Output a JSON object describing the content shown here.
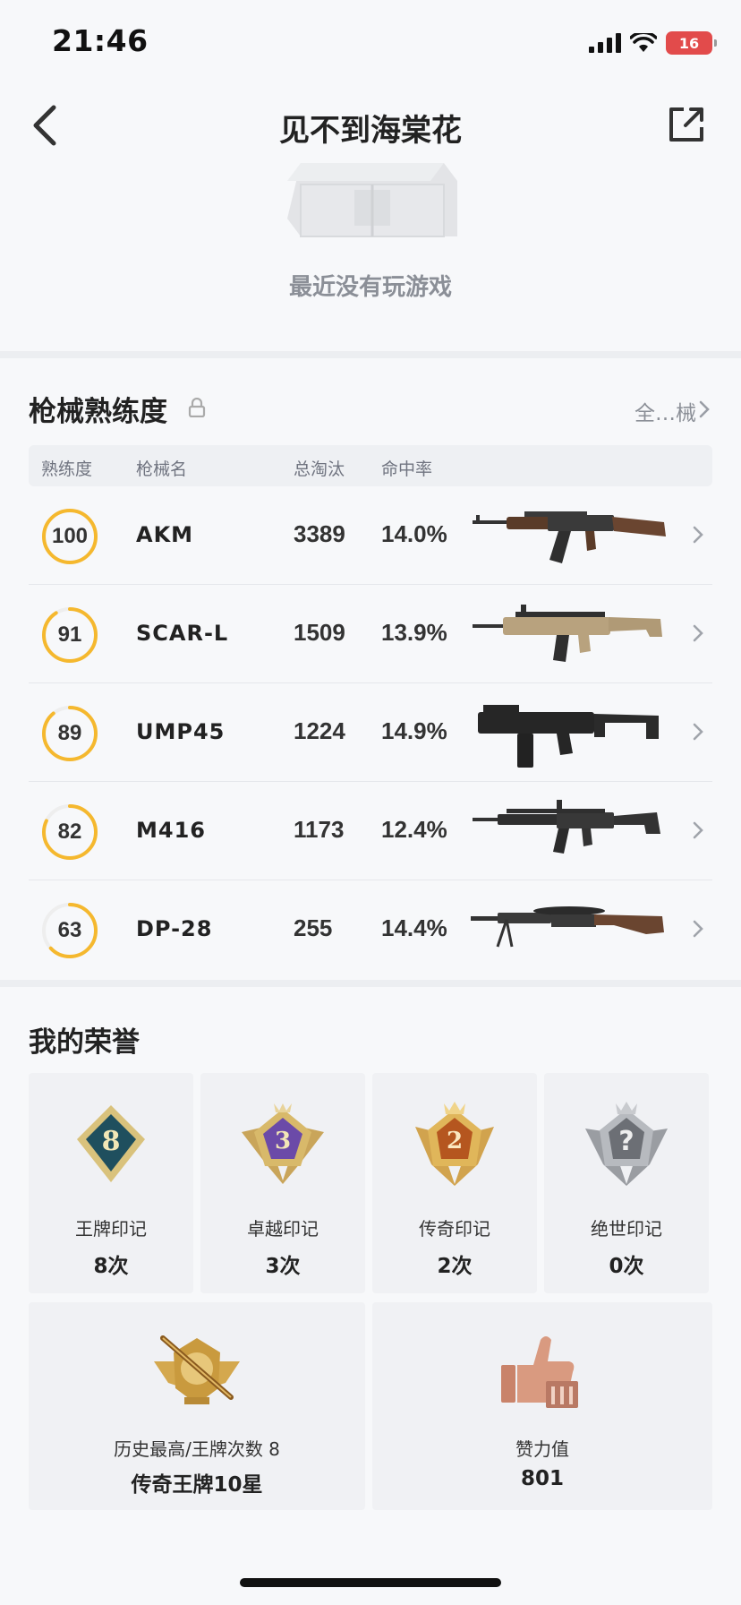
{
  "status_bar": {
    "time": "21:46",
    "battery": "16"
  },
  "header": {
    "title": "见不到海棠花"
  },
  "recent_games": {
    "empty_text": "最近没有玩游戏"
  },
  "weapons": {
    "title": "枪械熟练度",
    "all_link": "全…械",
    "columns": {
      "proficiency": "熟练度",
      "name": "枪械名",
      "kills": "总淘汰",
      "hit_rate": "命中率"
    },
    "rows": [
      {
        "proficiency": 100,
        "name": "AKM",
        "kills": "3389",
        "hit_rate": "14.0%"
      },
      {
        "proficiency": 91,
        "name": "SCAR-L",
        "kills": "1509",
        "hit_rate": "13.9%"
      },
      {
        "proficiency": 89,
        "name": "UMP45",
        "kills": "1224",
        "hit_rate": "14.9%"
      },
      {
        "proficiency": 82,
        "name": "M416",
        "kills": "1173",
        "hit_rate": "12.4%"
      },
      {
        "proficiency": 63,
        "name": "DP-28",
        "kills": "255",
        "hit_rate": "14.4%"
      }
    ]
  },
  "honors": {
    "title": "我的荣誉",
    "badges": [
      {
        "label": "王牌印记",
        "count": "8次",
        "badge_text": "8",
        "icon": "ace-mark-icon",
        "color": "#1f4f5e"
      },
      {
        "label": "卓越印记",
        "count": "3次",
        "badge_text": "3",
        "icon": "excellence-mark-icon",
        "color": "#6b4aa8"
      },
      {
        "label": "传奇印记",
        "count": "2次",
        "badge_text": "2",
        "icon": "legend-mark-icon",
        "color": "#b5561f"
      },
      {
        "label": "绝世印记",
        "count": "0次",
        "badge_text": "?",
        "icon": "peerless-mark-icon",
        "color": "#6c6f75"
      }
    ],
    "highest": {
      "label": "历史最高/王牌次数 8",
      "value": "传奇王牌10星",
      "icon": "legend-ace-icon"
    },
    "likes": {
      "label": "赞力值",
      "value": "801",
      "icon": "thumbs-up-icon"
    }
  },
  "colors": {
    "ring": "#f5b82e",
    "ring_track": "#eeeeee",
    "accent_red": "#e24b4b"
  }
}
